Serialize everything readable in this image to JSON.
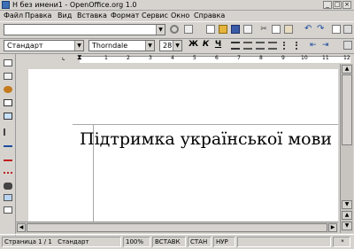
{
  "window": {
    "title": "Н без имени1 - OpenOffice.org 1.0",
    "minimize": "_",
    "maximize": "□",
    "close": "×"
  },
  "menu": [
    "Файл",
    "Правка",
    "Вид",
    "Вставка",
    "Формат",
    "Сервис",
    "Окно",
    "Справка"
  ],
  "toolbar_format": {
    "style_value": "Стандарт",
    "font_value": "Thorndale",
    "size_value": "28",
    "bold": "Ж",
    "italic": "К",
    "underline": "Ч"
  },
  "ruler": {
    "numbers": [
      "1",
      "2",
      "3",
      "4",
      "5",
      "6",
      "7",
      "8",
      "9",
      "10",
      "11",
      "12"
    ]
  },
  "document": {
    "text": "Підтримка української мови"
  },
  "status": {
    "page": "Страница  1 / 1",
    "style": "Стандарт",
    "zoom": "100%",
    "insert": "ВСТАВК",
    "mode": "СТАН",
    "hyperlink": "НУР",
    "modified": "*"
  }
}
